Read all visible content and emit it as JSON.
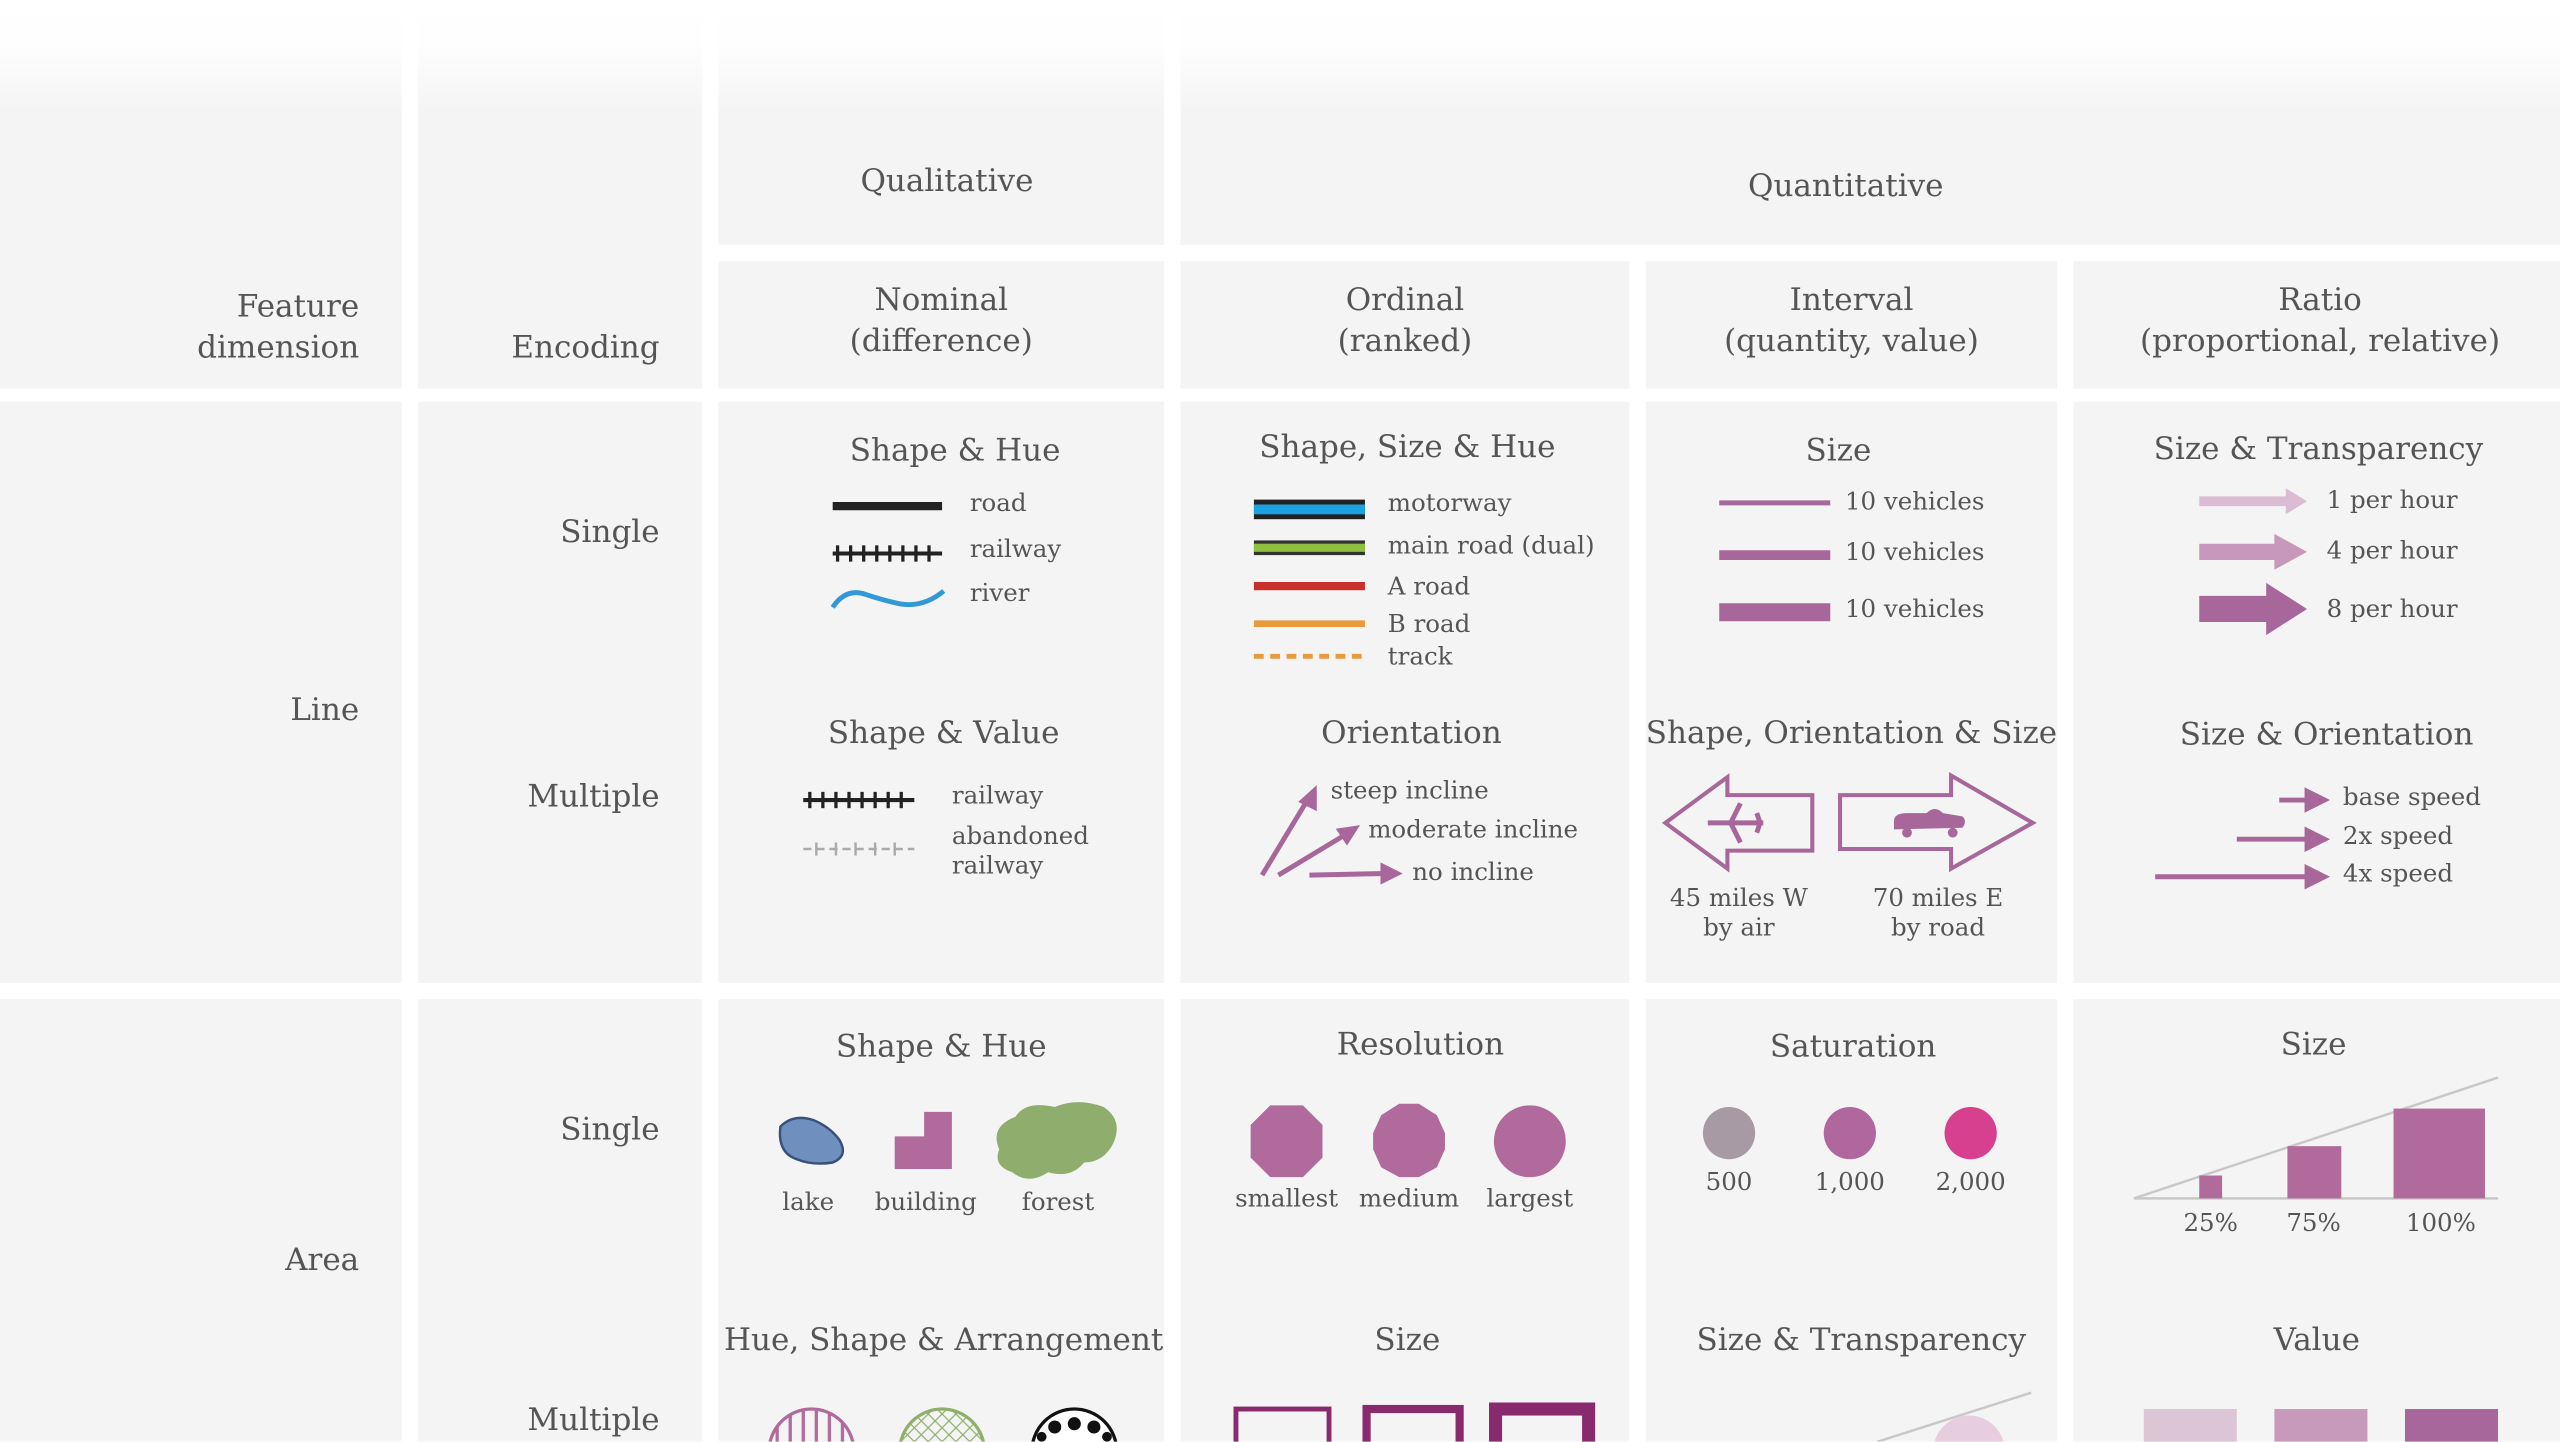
{
  "header": {
    "feature_dimension": "Feature\ndimension",
    "encoding": "Encoding",
    "qualitative": "Qualitative",
    "quantitative": "Quantitative",
    "nominal": "Nominal\n(difference)",
    "ordinal": "Ordinal\n(ranked)",
    "interval": "Interval\n(quantity, value)",
    "ratio": "Ratio\n(proportional, relative)"
  },
  "rows": {
    "line": "Line",
    "area": "Area",
    "single": "Single",
    "multiple": "Multiple"
  },
  "line_single": {
    "nominal": {
      "title": "Shape & Hue",
      "items": [
        "road",
        "railway",
        "river"
      ]
    },
    "ordinal": {
      "title": "Shape, Size & Hue",
      "items": [
        "motorway",
        "main road (dual)",
        "A road",
        "B road",
        "track"
      ]
    },
    "interval": {
      "title": "Size",
      "items": [
        "10 vehicles",
        "10 vehicles",
        "10 vehicles"
      ]
    },
    "ratio": {
      "title": "Size & Transparency",
      "items": [
        "1 per hour",
        "4 per hour",
        "8 per hour"
      ]
    }
  },
  "line_multiple": {
    "nominal": {
      "title": "Shape & Value",
      "items": [
        "railway",
        "abandoned\nrailway"
      ]
    },
    "ordinal": {
      "title": "Orientation",
      "items": [
        "steep incline",
        "moderate incline",
        "no incline"
      ]
    },
    "interval": {
      "title": "Shape, Orientation & Size",
      "items": [
        "45 miles W\nby air",
        "70 miles E\nby road"
      ]
    },
    "ratio": {
      "title": "Size & Orientation",
      "items": [
        "base speed",
        "2x speed",
        "4x speed"
      ]
    }
  },
  "area_single": {
    "nominal": {
      "title": "Shape & Hue",
      "items": [
        "lake",
        "building",
        "forest"
      ]
    },
    "ordinal": {
      "title": "Resolution",
      "items": [
        "smallest",
        "medium",
        "largest"
      ]
    },
    "interval": {
      "title": "Saturation",
      "items": [
        "500",
        "1,000",
        "2,000"
      ]
    },
    "ratio": {
      "title": "Size",
      "items": [
        "25%",
        "75%",
        "100%"
      ]
    }
  },
  "area_multiple": {
    "nominal": {
      "title": "Hue, Shape & Arrangement"
    },
    "ordinal": {
      "title": "Size"
    },
    "interval": {
      "title": "Size & Transparency"
    },
    "ratio": {
      "title": "Value"
    }
  },
  "colors": {
    "cell_bg": "#f4f4f4",
    "text": "#555555",
    "accent_purple": "#a8679a",
    "motorway_blue": "#1aa3e0",
    "main_road_green": "#8fbf3f",
    "a_road_red": "#c9302c",
    "b_road_orange": "#e89a3c",
    "river_blue": "#3399d6",
    "lake_blue": "#6f8fbf",
    "forest_green": "#8fad6c",
    "saturation_low": "#a89aa4",
    "saturation_mid": "#b0679e",
    "saturation_high": "#d6408e"
  }
}
